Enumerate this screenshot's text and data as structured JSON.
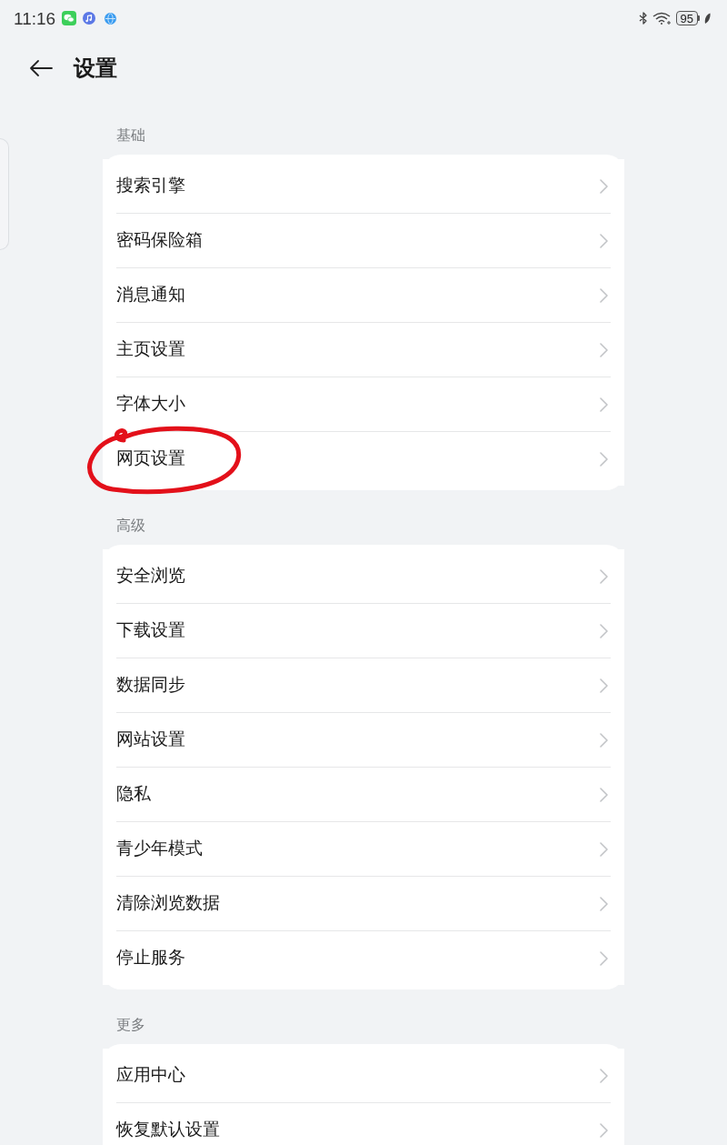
{
  "status_bar": {
    "time": "11:16",
    "battery": "95"
  },
  "header": {
    "title": "设置"
  },
  "sections": [
    {
      "title": "基础",
      "items": [
        {
          "label": "搜索引擎",
          "circled": false
        },
        {
          "label": "密码保险箱",
          "circled": false
        },
        {
          "label": "消息通知",
          "circled": false
        },
        {
          "label": "主页设置",
          "circled": false
        },
        {
          "label": "字体大小",
          "circled": false
        },
        {
          "label": "网页设置",
          "circled": true
        }
      ]
    },
    {
      "title": "高级",
      "items": [
        {
          "label": "安全浏览",
          "circled": false
        },
        {
          "label": "下载设置",
          "circled": false
        },
        {
          "label": "数据同步",
          "circled": false
        },
        {
          "label": "网站设置",
          "circled": false
        },
        {
          "label": "隐私",
          "circled": false
        },
        {
          "label": "青少年模式",
          "circled": false
        },
        {
          "label": "清除浏览数据",
          "circled": false
        },
        {
          "label": "停止服务",
          "circled": false
        }
      ]
    },
    {
      "title": "更多",
      "items": [
        {
          "label": "应用中心",
          "circled": false
        },
        {
          "label": "恢复默认设置",
          "circled": false
        }
      ]
    }
  ]
}
